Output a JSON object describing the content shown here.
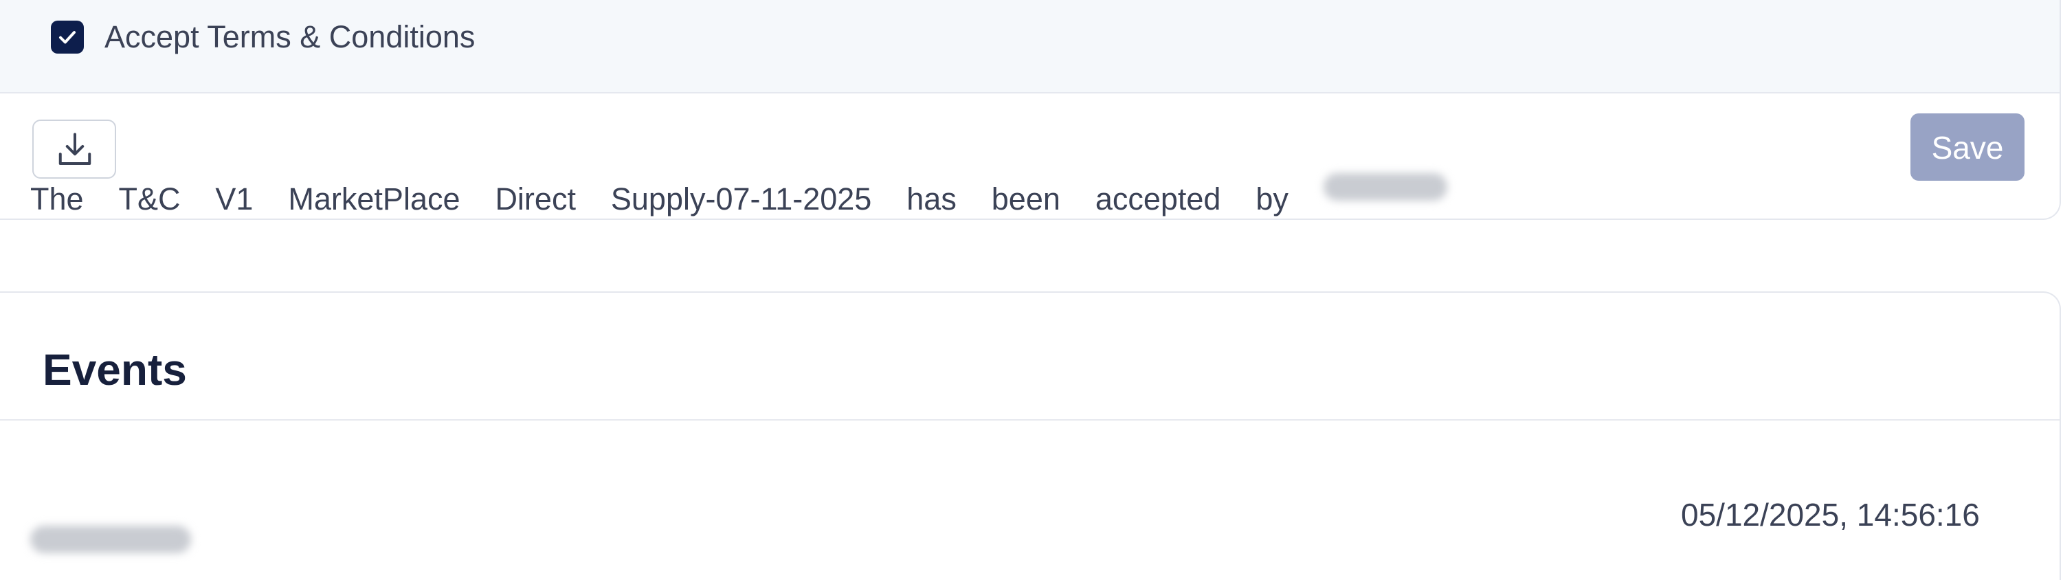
{
  "terms": {
    "checked": true,
    "label": "Accept Terms & Conditions"
  },
  "toolbar": {
    "download_icon": "download-icon",
    "save_label": "Save"
  },
  "events": {
    "title": "Events",
    "items": [
      {
        "text_words": [
          "The",
          "T&C",
          "V1",
          "MarketPlace",
          "Direct",
          "Supply-07-11-2025",
          "has",
          "been",
          "accepted",
          "by"
        ],
        "user_redacted": true,
        "timestamp": "05/12/2025, 14:56:16"
      }
    ]
  },
  "colors": {
    "accent_dark": "#0d1e4c",
    "save_disabled": "#98a3c5",
    "row_background": "#f5f8fb"
  }
}
